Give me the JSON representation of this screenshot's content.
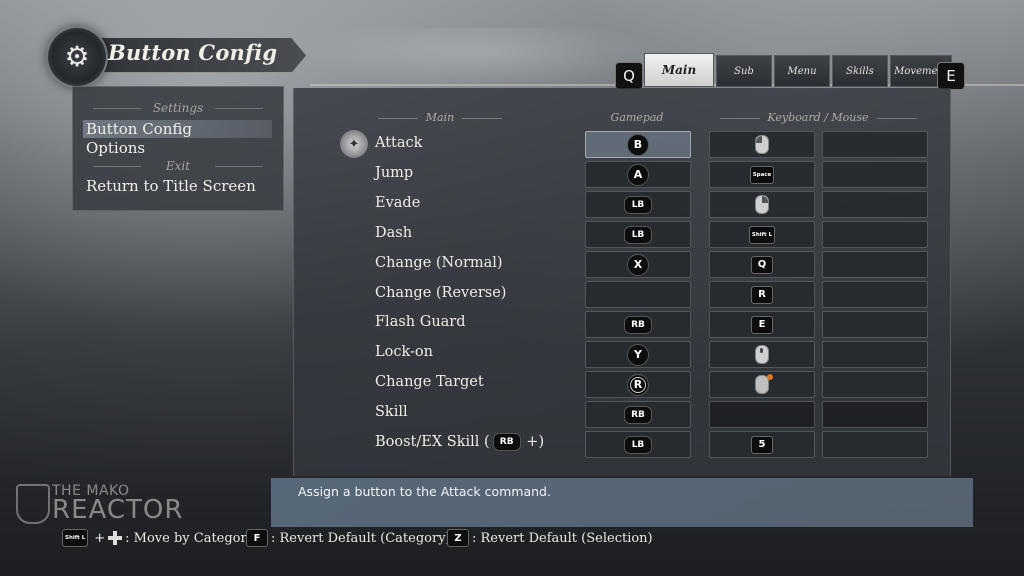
{
  "header": {
    "title": "Button Config",
    "emblem_icon": "gear-icon"
  },
  "tabs": {
    "prev_key": "Q",
    "next_key": "E",
    "items": [
      {
        "label": "Main",
        "active": true
      },
      {
        "label": "Sub",
        "active": false
      },
      {
        "label": "Menu",
        "active": false
      },
      {
        "label": "Skills",
        "active": false
      },
      {
        "label": "Movement",
        "active": false
      }
    ]
  },
  "left_menu": {
    "settings_header": "Settings",
    "items_settings": [
      "Button Config",
      "Options"
    ],
    "exit_header": "Exit",
    "items_exit": [
      "Return to Title Screen"
    ],
    "selected": "Button Config"
  },
  "columns": {
    "main": "Main",
    "gamepad": "Gamepad",
    "keyboard_mouse": "Keyboard / Mouse"
  },
  "actions": [
    {
      "label": "Attack",
      "gamepad": "B",
      "kb1": "mouse-left",
      "kb2": ""
    },
    {
      "label": "Jump",
      "gamepad": "A",
      "kb1": "Space",
      "kb2": ""
    },
    {
      "label": "Evade",
      "gamepad": "LB",
      "kb1": "mouse-right",
      "kb2": ""
    },
    {
      "label": "Dash",
      "gamepad": "LB",
      "kb1": "Shift L",
      "kb2": ""
    },
    {
      "label": "Change (Normal)",
      "gamepad": "X",
      "kb1": "Q",
      "kb2": ""
    },
    {
      "label": "Change (Reverse)",
      "gamepad": "",
      "kb1": "R",
      "kb2": ""
    },
    {
      "label": "Flash Guard",
      "gamepad": "RB",
      "kb1": "E",
      "kb2": ""
    },
    {
      "label": "Lock-on",
      "gamepad": "Y",
      "kb1": "mouse-wheel",
      "kb2": ""
    },
    {
      "label": "Change Target",
      "gamepad": "R",
      "kb1": "mouse-move",
      "kb2": ""
    },
    {
      "label": "Skill",
      "gamepad": "RB",
      "kb1": "",
      "kb2": ""
    },
    {
      "label": "Boost/EX Skill (",
      "label_suffix": " +)",
      "inline_pill": "RB",
      "gamepad": "LB",
      "kb1": "5",
      "kb2": ""
    }
  ],
  "description": "Assign a button to the Attack command.",
  "watermark": {
    "line1": "THE MAKO",
    "line2": "REACTOR"
  },
  "hints": {
    "move_key": "Shift L",
    "move_label": ": Move by Category",
    "revert_cat_key": "F",
    "revert_cat_label": ": Revert Default (Category)",
    "revert_sel_key": "Z",
    "revert_sel_label": ": Revert Default (Selection)"
  }
}
